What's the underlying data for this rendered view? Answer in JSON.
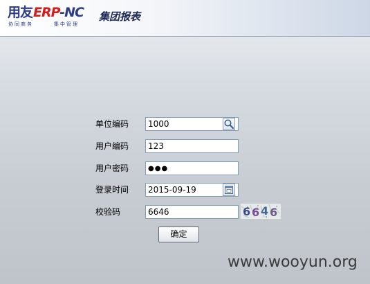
{
  "header": {
    "logo": {
      "brand": "用友",
      "product": "ERP",
      "suffix": "-NC",
      "tagline_left": "协同商务",
      "tagline_right": "集中管理"
    },
    "title": "集团报表"
  },
  "login_form": {
    "org_code": {
      "label": "单位编码",
      "value": "1000",
      "button_icon": "search-icon"
    },
    "user_code": {
      "label": "用户编码",
      "value": "123"
    },
    "password": {
      "label": "用户密码",
      "value": "●●●"
    },
    "login_date": {
      "label": "登录时间",
      "value": "2015-09-19",
      "button_icon": "calendar-icon"
    },
    "captcha": {
      "label": "校验码",
      "value": "6646",
      "image_text": "6646"
    },
    "submit_label": "确定"
  },
  "watermark": "www.wooyun.org",
  "colors": {
    "field_border": "#7f9db9",
    "title": "#1f2a55",
    "logo_blue": "#2e3c86",
    "logo_red": "#d41c1c"
  }
}
